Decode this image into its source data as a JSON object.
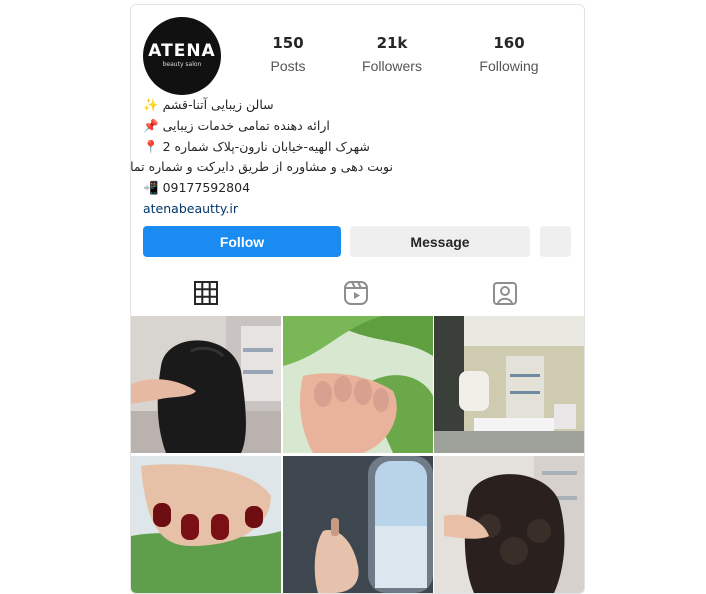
{
  "profile": {
    "avatar_brand": "ATENA",
    "avatar_tagline": "beauty salon",
    "stats": [
      {
        "value": "150",
        "label": "Posts"
      },
      {
        "value": "21k",
        "label": "Followers"
      },
      {
        "value": "160",
        "label": "Following"
      }
    ],
    "bio": {
      "line1": "سالن زیبایی آتنا-قشم",
      "line1_icon": "✨",
      "line2": "ارائه دهنده تمامی خدمات زیبایی",
      "line2_icon": "📌",
      "line3": "شهرک الهیه-خیابان نارون-پلاک شماره 2",
      "line3_icon": "📍",
      "line4": "نوبت دهی و مشاوره از طریق دایرکت و شماره تماس زیر",
      "line5": "09177592804",
      "line5_icon": "📲",
      "website": "atenabeautty.ir"
    }
  },
  "actions": {
    "follow_label": "Follow",
    "message_label": "Message",
    "more_icon": "person-add-icon"
  },
  "tabs": [
    {
      "icon": "grid-icon",
      "active": true
    },
    {
      "icon": "reels-icon",
      "active": false
    },
    {
      "icon": "tagged-icon",
      "active": false
    }
  ],
  "colors": {
    "follow_button": "#1a8bf0",
    "secondary_button": "#efefef",
    "link": "#00376b"
  }
}
